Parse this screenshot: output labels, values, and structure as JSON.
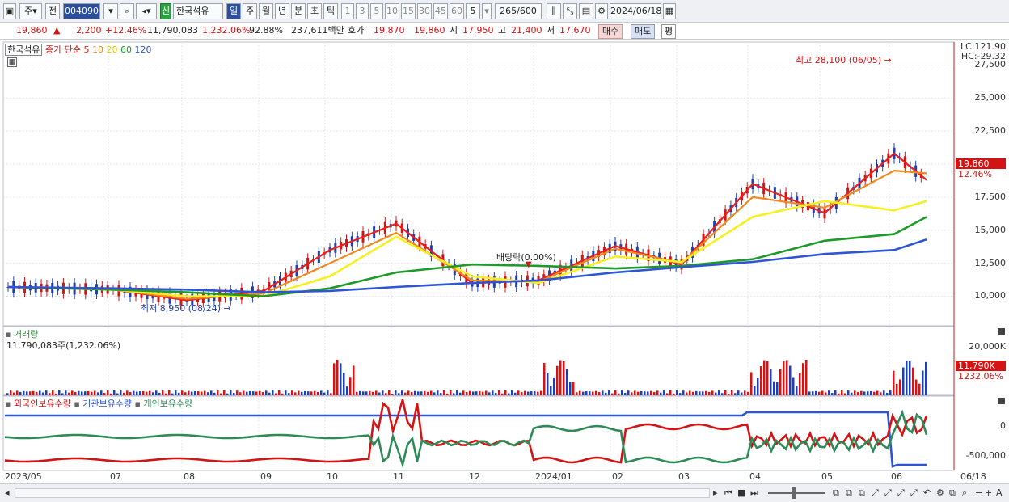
{
  "toolbar": {
    "type_label": "주",
    "prev_label": "전",
    "code": "004090",
    "sin_label": "신",
    "stock_name": "한국석유",
    "period_tabs": [
      "일",
      "주",
      "월",
      "년",
      "분",
      "초",
      "틱"
    ],
    "active_period": "일",
    "intervals": [
      "1",
      "3",
      "5",
      "10",
      "15",
      "30",
      "45",
      "60"
    ],
    "count_value": "5",
    "bars_value": "265",
    "bars_max": "/600",
    "date": "2024/06/18"
  },
  "info": {
    "price": "19,860",
    "change_arrow": "▲",
    "change": "2,200",
    "change_pct": "+12.46%",
    "volume": "11,790,083",
    "volume_pct": "1,232.06%",
    "ratio": "92.88%",
    "amount": "237,611백만",
    "hoga_label": "호가",
    "ask": "19,870",
    "bid": "19,860",
    "open_label": "시",
    "open": "17,950",
    "high_label": "고",
    "high": "21,400",
    "low_label": "저",
    "low": "17,670",
    "buy_label": "매수",
    "sell_label": "매도",
    "eval_label": "평"
  },
  "price_panel": {
    "name_tag": "한국석유",
    "legend_prefix": "종가 단순",
    "ma_labels": [
      "5",
      "10",
      "20",
      "60",
      "120"
    ],
    "lc_label": "LC:121.90",
    "hc_label": "HC:-29.32",
    "y_ticks": [
      "27,500",
      "25,000",
      "22,500",
      "20,000",
      "17,500",
      "15,000",
      "12,500",
      "10,000"
    ],
    "current_price_tag": "19,860",
    "current_pct_tag": "12.46%",
    "high_annotation": "최고 28,100 (06/05)",
    "low_annotation": "최저 8,950 (08/24)",
    "dividend_annotation": "배당락(0.00%)"
  },
  "volume_panel": {
    "title": "거래량",
    "value_label": "11,790,083주(1,232.06%)",
    "y_tick": "20,000K",
    "current_tag": "11,790K",
    "current_pct": "1232.06%"
  },
  "holding_panel": {
    "legend": [
      "외국인보유수량",
      "기관보유수량",
      "개인보유수량"
    ],
    "y_ticks": [
      "0",
      "-500,000"
    ]
  },
  "x_axis": [
    "2023/05",
    "07",
    "08",
    "09",
    "10",
    "11",
    "12",
    "2024/01",
    "02",
    "03",
    "04",
    "05",
    "06",
    "06/18"
  ],
  "colors": {
    "up": "#d21414",
    "down": "#1f3fb0",
    "ma5": "#e8211e",
    "ma10": "#f08a1c",
    "ma20": "#f5f020",
    "ma60": "#1e9a2a",
    "ma120": "#2f55d4"
  },
  "chart_data": {
    "type": "line",
    "title": "한국석유",
    "xlabel": "",
    "ylabel": "",
    "x": [
      "2023/05",
      "07",
      "08",
      "09",
      "10",
      "11",
      "12",
      "2024/01",
      "02",
      "03",
      "04",
      "05",
      "06",
      "06/18"
    ],
    "ylim": [
      8500,
      28500
    ],
    "series": [
      {
        "name": "5",
        "values": [
          10700,
          10500,
          9700,
          10400,
          13500,
          15500,
          11000,
          11200,
          13800,
          12400,
          18500,
          16300,
          20800,
          18800
        ]
      },
      {
        "name": "10",
        "values": [
          10700,
          10500,
          9800,
          10200,
          12500,
          14800,
          11200,
          11100,
          13600,
          12500,
          17500,
          16700,
          19500,
          19300
        ]
      },
      {
        "name": "20",
        "values": [
          10700,
          10500,
          10000,
          10000,
          11500,
          14500,
          11500,
          11000,
          13000,
          12600,
          16000,
          17200,
          16500,
          17200
        ]
      },
      {
        "name": "60",
        "values": [
          10700,
          10500,
          10300,
          10000,
          10600,
          11800,
          12400,
          12300,
          12100,
          12300,
          12800,
          14200,
          14700,
          16000
        ]
      },
      {
        "name": "120",
        "values": [
          10700,
          10600,
          10500,
          10300,
          10400,
          10700,
          11000,
          11200,
          11800,
          12200,
          12600,
          13200,
          13500,
          14300
        ]
      }
    ],
    "annotations": [
      "최고 28,100 (06/05)",
      "최저 8,950 (08/24)",
      "배당락(0.00%)"
    ]
  }
}
